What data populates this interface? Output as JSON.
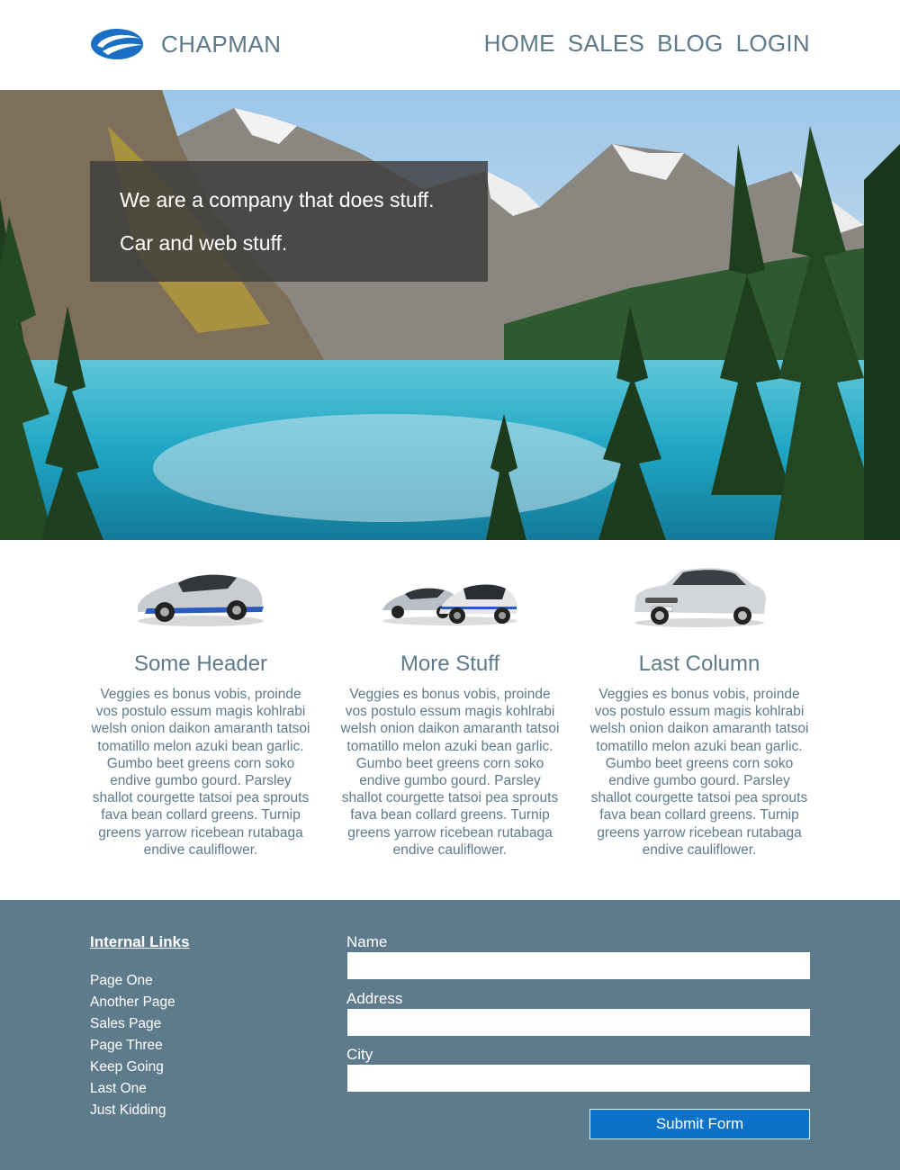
{
  "header": {
    "brand": "CHAPMAN",
    "logo_icon": "swoosh-logo-icon",
    "nav": [
      "HOME",
      "SALES",
      "BLOG",
      "LOGIN"
    ]
  },
  "hero": {
    "line1": "We are a company that does stuff.",
    "line2": "Car and web stuff."
  },
  "columns": [
    {
      "image_icon": "sports-car-image",
      "title": "Some Header",
      "text": "Veggies es bonus vobis, proinde vos postulo essum magis kohlrabi welsh onion daikon amaranth tatsoi tomatillo melon azuki bean garlic. Gumbo beet greens corn soko endive gumbo gourd. Parsley shallot courgette tatsoi pea sprouts fava bean collard greens. Turnip greens yarrow ricebean rutabaga endive cauliflower."
    },
    {
      "image_icon": "two-cars-image",
      "title": "More Stuff",
      "text": "Veggies es bonus vobis, proinde vos postulo essum magis kohlrabi welsh onion daikon amaranth tatsoi tomatillo melon azuki bean garlic. Gumbo beet greens corn soko endive gumbo gourd. Parsley shallot courgette tatsoi pea sprouts fava bean collard greens. Turnip greens yarrow ricebean rutabaga endive cauliflower."
    },
    {
      "image_icon": "sedan-car-image",
      "title": "Last Column",
      "text": "Veggies es bonus vobis, proinde vos postulo essum magis kohlrabi welsh onion daikon amaranth tatsoi tomatillo melon azuki bean garlic. Gumbo beet greens corn soko endive gumbo gourd. Parsley shallot courgette tatsoi pea sprouts fava bean collard greens. Turnip greens yarrow ricebean rutabaga endive cauliflower."
    }
  ],
  "footer": {
    "links_title": "Internal Links",
    "links": [
      "Page One",
      "Another Page",
      "Sales Page",
      "Page Three",
      "Keep Going",
      "Last One",
      "Just Kidding"
    ],
    "form": {
      "name_label": "Name",
      "name_value": "",
      "address_label": "Address",
      "address_value": "",
      "city_label": "City",
      "city_value": "",
      "submit_label": "Submit Form"
    }
  },
  "colors": {
    "text": "#5e7a8a",
    "footer_bg": "#5e7b8b",
    "accent": "#0a72c9",
    "logo": "#1a6fc4"
  }
}
